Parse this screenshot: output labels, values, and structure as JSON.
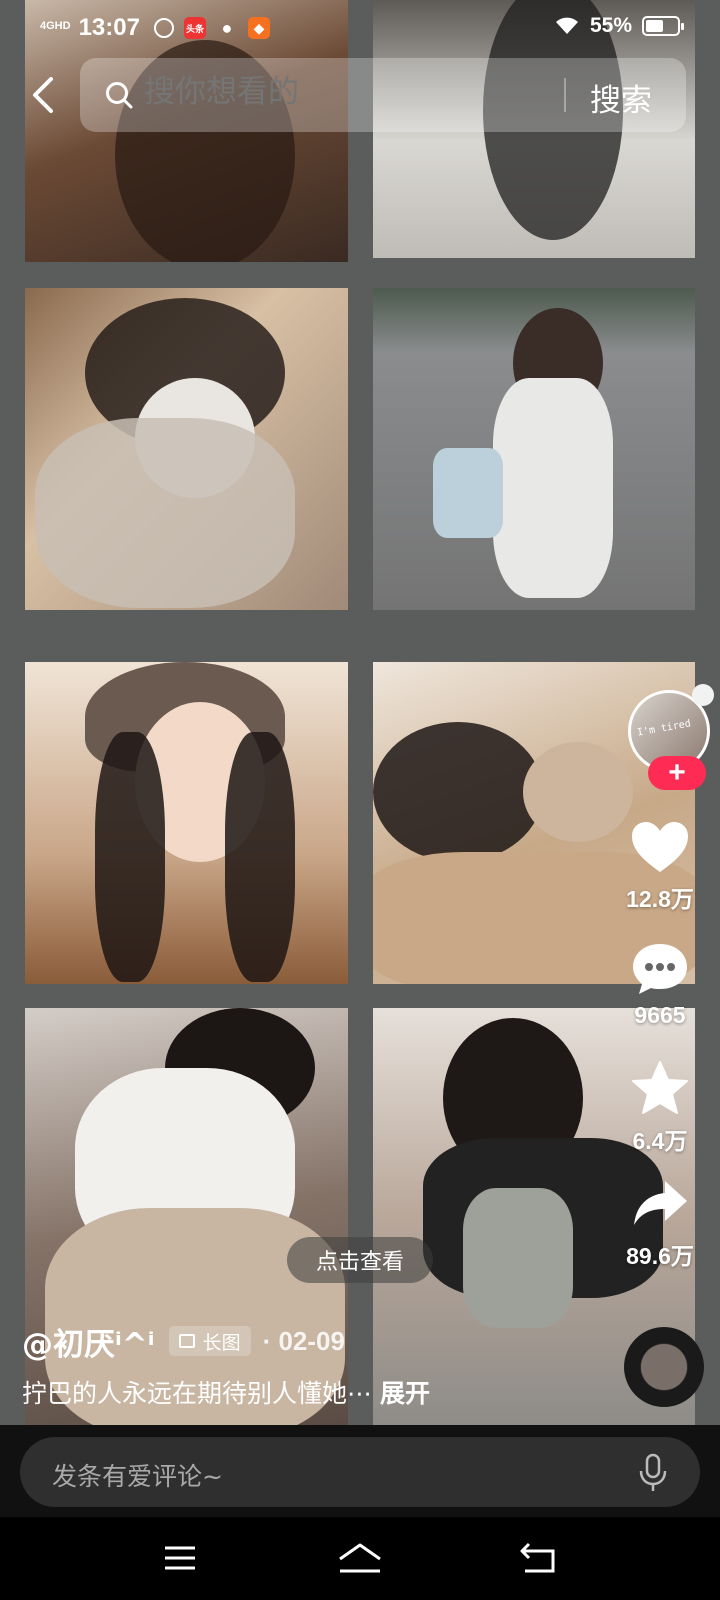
{
  "status_bar": {
    "network": "4GHD",
    "time": "13:07",
    "app_badge": "头条",
    "battery": "55%",
    "battery_level": 0.55
  },
  "search": {
    "placeholder": "搜你想看的",
    "button_label": "搜索"
  },
  "actions": {
    "avatar_text": "I'm tired",
    "likes": "12.8万",
    "comments": "9665",
    "favorites": "6.4万",
    "shares": "89.6万"
  },
  "post": {
    "view_prompt": "点击查看",
    "author": "@初厌ⁱ^ⁱ",
    "badge": "长图",
    "date": "· 02-09",
    "caption": "拧巴的人永远在期待别人懂她⋯",
    "expand_label": "展开"
  },
  "comment_bar": {
    "placeholder": "发条有爱评论~"
  },
  "colors": {
    "follow_red": "#fe2c55",
    "background_gray": "#5b5d5c"
  },
  "icons": [
    "back-icon",
    "search-icon",
    "heart-icon",
    "comment-icon",
    "star-icon",
    "share-icon",
    "mic-icon",
    "menu-icon",
    "home-icon",
    "return-icon"
  ]
}
